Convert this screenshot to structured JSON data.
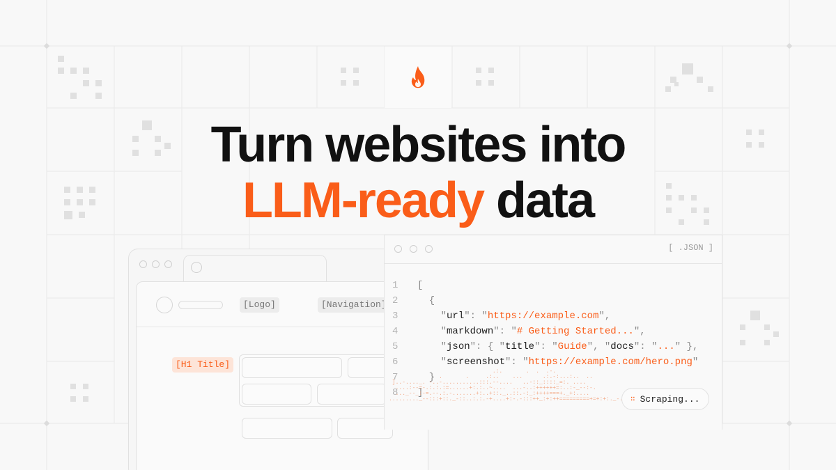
{
  "headline": {
    "line1": "Turn websites into",
    "accent": "LLM-ready",
    "line2_rest": "data"
  },
  "colors": {
    "accent": "#fa5d19",
    "background": "#f8f8f8",
    "grid": "#e9e9e9",
    "pixel": "#e0e0e0"
  },
  "logo": {
    "icon": "flame-icon"
  },
  "browser": {
    "logo_tag": "[Logo]",
    "nav_tag": "[Navigation]",
    "h1_tag": "[H1 Title]"
  },
  "json_panel": {
    "format_label": "[ .JSON ]",
    "lines": [
      {
        "n": "1",
        "parts": [
          [
            "p",
            "["
          ]
        ]
      },
      {
        "n": "2",
        "parts": [
          [
            "p",
            "  {"
          ]
        ]
      },
      {
        "n": "3",
        "parts": [
          [
            "p",
            "    \""
          ],
          [
            "k",
            "url"
          ],
          [
            "p",
            "\": \""
          ],
          [
            "s",
            "https://example.com"
          ],
          [
            "p",
            "\","
          ]
        ]
      },
      {
        "n": "4",
        "parts": [
          [
            "p",
            "    \""
          ],
          [
            "k",
            "markdown"
          ],
          [
            "p",
            "\": \""
          ],
          [
            "s",
            "# Getting Started..."
          ],
          [
            "p",
            "\","
          ]
        ]
      },
      {
        "n": "5",
        "parts": [
          [
            "p",
            "    \""
          ],
          [
            "k",
            "json"
          ],
          [
            "p",
            "\": { \""
          ],
          [
            "k",
            "title"
          ],
          [
            "p",
            "\": \""
          ],
          [
            "s",
            "Guide"
          ],
          [
            "p",
            "\", \""
          ],
          [
            "k",
            "docs"
          ],
          [
            "p",
            "\": \""
          ],
          [
            "s",
            "..."
          ],
          [
            "p",
            "\" },"
          ]
        ]
      },
      {
        "n": "6",
        "parts": [
          [
            "p",
            "    \""
          ],
          [
            "k",
            "screenshot"
          ],
          [
            "p",
            "\": \""
          ],
          [
            "s",
            "https://example.com/hero.png"
          ],
          [
            "p",
            "\""
          ]
        ]
      },
      {
        "n": "7",
        "parts": [
          [
            "p",
            "  }"
          ]
        ]
      },
      {
        "n": "8",
        "parts": [
          [
            "p",
            "]"
          ]
        ]
      }
    ],
    "status_icon": "dots-icon",
    "status_label": "Scraping..."
  }
}
